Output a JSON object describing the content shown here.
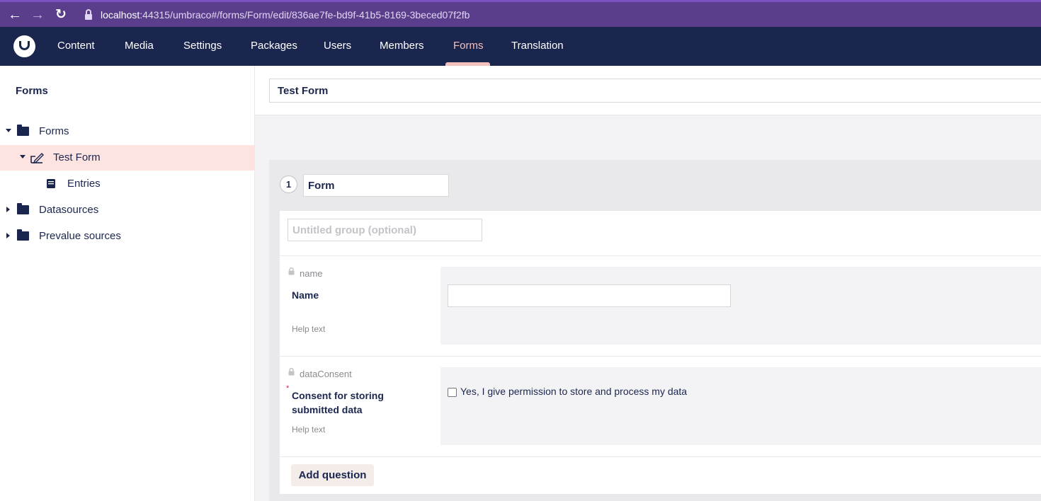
{
  "browser": {
    "url_host": "localhost",
    "url_rest": ":44315/umbraco#/forms/Form/edit/836ae7fe-bd9f-41b5-8169-3beced07f2fb",
    "back_glyph": "←",
    "forward_glyph": "→",
    "reload_glyph": "↻"
  },
  "top_nav": {
    "items": [
      {
        "label": "Content"
      },
      {
        "label": "Media"
      },
      {
        "label": "Settings"
      },
      {
        "label": "Packages"
      },
      {
        "label": "Users"
      },
      {
        "label": "Members"
      },
      {
        "label": "Forms",
        "active": true
      },
      {
        "label": "Translation"
      }
    ]
  },
  "sidebar": {
    "title": "Forms",
    "tree": [
      {
        "label": "Forms",
        "icon": "folder-icon",
        "expanded": true
      },
      {
        "label": "Test Form",
        "icon": "form-edit-icon",
        "expanded": true,
        "selected": true
      },
      {
        "label": "Entries",
        "icon": "entries-icon"
      },
      {
        "label": "Datasources",
        "icon": "folder-icon",
        "expanded": false
      },
      {
        "label": "Prevalue sources",
        "icon": "folder-icon",
        "expanded": false
      }
    ]
  },
  "main": {
    "form_name": "Test Form",
    "page": {
      "number": "1",
      "name": "Form"
    },
    "group": {
      "name_placeholder": "Untitled group (optional)"
    },
    "fields": [
      {
        "alias": "name",
        "label": "Name",
        "help": "Help text",
        "required": false
      },
      {
        "alias": "dataConsent",
        "label": "Consent for storing submitted data",
        "help": "Help text",
        "required": true,
        "required_mark": "*",
        "checkbox_label": "Yes, I give permission to store and process my data"
      }
    ],
    "add_question_label": "Add question"
  },
  "colors": {
    "nav_bg": "#1b264f",
    "accent": "#f5c1bc",
    "selected_bg": "#fde4e1",
    "browser_bg": "#5a3e8c"
  }
}
